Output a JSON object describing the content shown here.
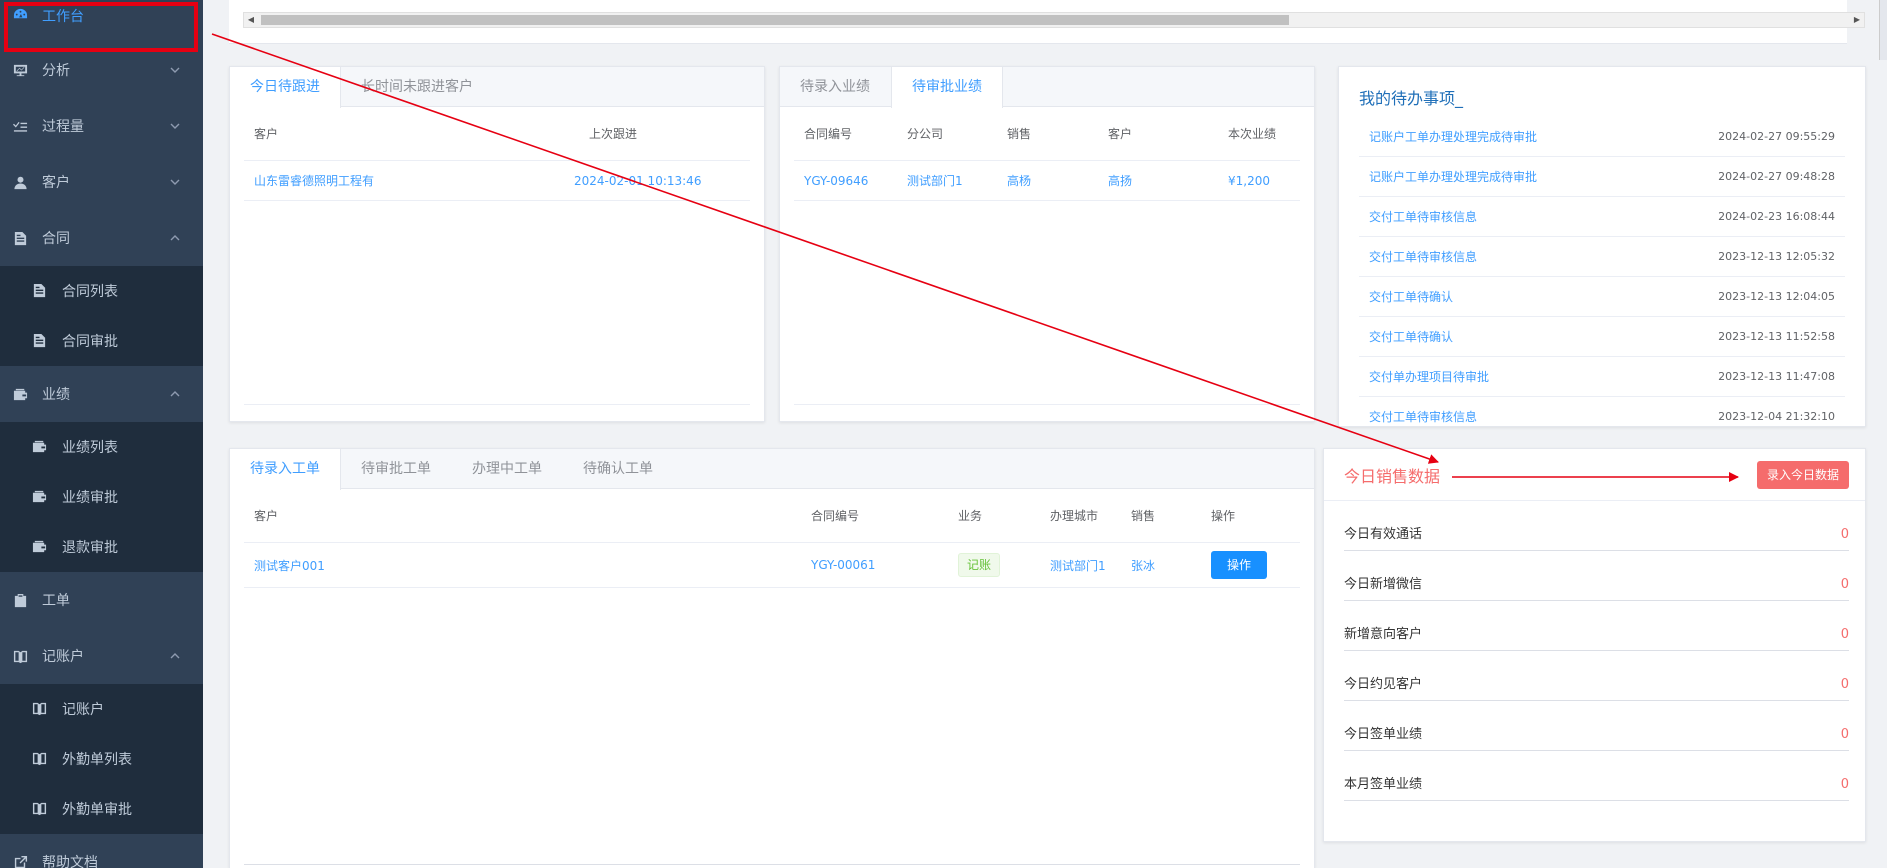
{
  "sidebar": {
    "items": [
      {
        "label": "工作台",
        "icon": "dashboard-icon"
      },
      {
        "label": "分析",
        "icon": "chart-icon"
      },
      {
        "label": "过程量",
        "icon": "list-check-icon"
      },
      {
        "label": "客户",
        "icon": "user-icon"
      },
      {
        "label": "合同",
        "icon": "file-icon",
        "children": [
          "合同列表",
          "合同审批"
        ]
      },
      {
        "label": "业绩",
        "icon": "wallet-icon",
        "children": [
          "业绩列表",
          "业绩审批",
          "退款审批"
        ]
      },
      {
        "label": "工单",
        "icon": "clipboard-icon"
      },
      {
        "label": "记账户",
        "icon": "book-icon",
        "children": [
          "记账户",
          "外勤单列表",
          "外勤单审批"
        ]
      },
      {
        "label": "帮助文档",
        "icon": "external-link-icon"
      }
    ]
  },
  "followup": {
    "tabs": [
      "今日待跟进",
      "长时间未跟进客户"
    ],
    "columns": [
      "客户",
      "上次跟进"
    ],
    "rows": [
      [
        "山东雷睿德照明工程有",
        "2024-02-01 10:13:46"
      ]
    ]
  },
  "performance": {
    "tabs": [
      "待录入业绩",
      "待审批业绩"
    ],
    "columns": [
      "合同编号",
      "分公司",
      "销售",
      "客户",
      "本次业绩"
    ],
    "rows": [
      [
        "YGY-09646",
        "测试部门1",
        "高杨",
        "高扬",
        "¥1,200"
      ]
    ]
  },
  "todo": {
    "title": "我的待办事项_",
    "items": [
      {
        "label": "记账户工单办理处理完成待审批",
        "time": "2024-02-27 09:55:29"
      },
      {
        "label": "记账户工单办理处理完成待审批",
        "time": "2024-02-27 09:48:28"
      },
      {
        "label": "交付工单待审核信息",
        "time": "2024-02-23 16:08:44"
      },
      {
        "label": "交付工单待审核信息",
        "time": "2023-12-13 12:05:32"
      },
      {
        "label": "交付工单待确认",
        "time": "2023-12-13 12:04:05"
      },
      {
        "label": "交付工单待确认",
        "time": "2023-12-13 11:52:58"
      },
      {
        "label": "交付单办理项目待审批",
        "time": "2023-12-13 11:47:08"
      },
      {
        "label": "交付工单待审核信息",
        "time": "2023-12-04 21:32:10"
      }
    ]
  },
  "workorders": {
    "tabs": [
      "待录入工单",
      "待审批工单",
      "办理中工单",
      "待确认工单"
    ],
    "columns": [
      "客户",
      "合同编号",
      "业务",
      "办理城市",
      "销售",
      "操作"
    ],
    "rows": [
      {
        "customer": "测试客户001",
        "contract": "YGY-00061",
        "business": "记账",
        "city": "测试部门1",
        "sales": "张冰",
        "action": "操作"
      }
    ]
  },
  "sales": {
    "title": "今日销售数据",
    "button": "录入今日数据",
    "stats": [
      {
        "label": "今日有效通话",
        "value": "0"
      },
      {
        "label": "今日新增微信",
        "value": "0"
      },
      {
        "label": "新增意向客户",
        "value": "0"
      },
      {
        "label": "今日约见客户",
        "value": "0"
      },
      {
        "label": "今日签单业绩",
        "value": "0"
      },
      {
        "label": "本月签单业绩",
        "value": "0"
      }
    ]
  },
  "colors": {
    "accent": "#409eff",
    "sidebar": "#304156",
    "submenu": "#1f2d3d",
    "annotation": "#e60012",
    "danger": "#f56c6c"
  }
}
